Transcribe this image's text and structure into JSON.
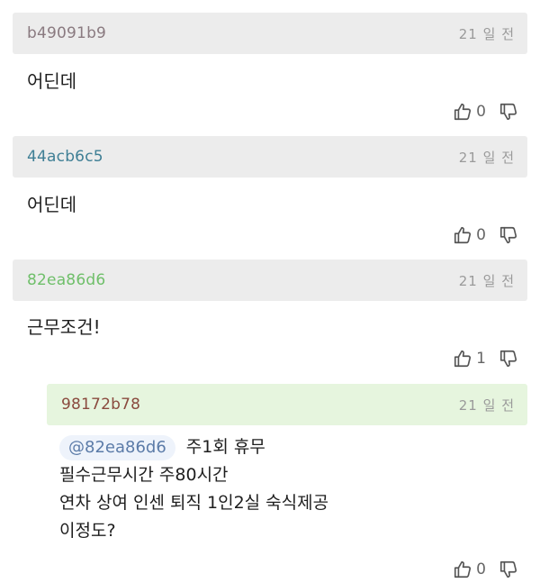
{
  "comments": [
    {
      "author": "b49091b9",
      "author_color": "#8a7a80",
      "time": "21 일 전",
      "text": "어딘데",
      "likes": "0"
    },
    {
      "author": "44acb6c5",
      "author_color": "#3f7f95",
      "time": "21 일 전",
      "text": "어딘데",
      "likes": "0"
    },
    {
      "author": "82ea86d6",
      "author_color": "#6fbf6a",
      "time": "21 일 전",
      "text": "근무조건!",
      "likes": "1"
    }
  ],
  "reply": {
    "author": "98172b78",
    "author_color": "#8a4a3e",
    "time": "21 일 전",
    "mention": "@82ea86d6",
    "lines": [
      "주1회 휴무",
      "필수근무시간 주80시간",
      "연차 상여 인센 퇴직 1인2실 숙식제공",
      "이정도?"
    ],
    "likes": "0"
  },
  "icons": {
    "like": "thumbs-up-icon",
    "dislike": "thumbs-down-icon"
  }
}
